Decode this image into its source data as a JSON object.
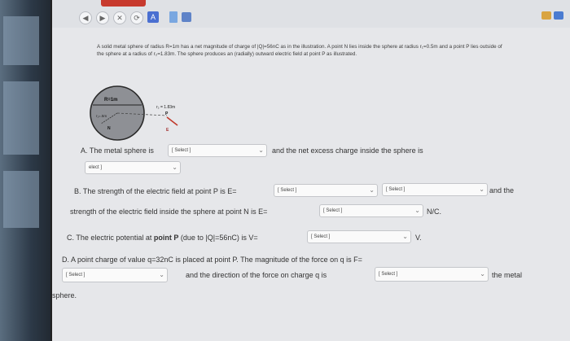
{
  "browser": {
    "toolbar_buttons": [
      "◀",
      "▶",
      "✕",
      "⟳",
      "A"
    ],
    "accent_tab_color": "#c73a2e"
  },
  "problem": {
    "intro": "A solid metal sphere of radius R=1m has a net magnitude of charge of |Q|=56nC as in the illustration. A point N lies inside the sphere at radius r₁=0.5m and a point P lies outside of the sphere at a radius of r₂=1.83m. The sphere produces an (radially) outward electric field at point P as illustrated."
  },
  "diagram": {
    "radius_label": "R=1m",
    "r1_label": "r₁=.5m",
    "n_label": "N",
    "r2_label": "r₂ = 1.83m",
    "p_label": "P",
    "e_label": "E"
  },
  "questions": {
    "a_prefix": "A. The metal sphere is",
    "a_mid": "and the net excess charge inside the sphere is",
    "b_prefix": "B. The strength of the electric field at point P is E=",
    "b_suffix": "and the",
    "b_line2": "strength of the electric field inside the sphere at point N is E=",
    "b_unit": "N/C.",
    "c_prefix": "C. The electric potential at",
    "c_bold": "point P",
    "c_middle": "(due to |Q|=56nC) is V=",
    "c_unit": "V.",
    "d_line1": "D. A point charge of value q=32nC is placed at point P.  The magnitude of the force on q is F=",
    "d_mid": "and the direction of the force on charge q is",
    "d_suffix": "the metal",
    "d_line3": "sphere."
  },
  "selects": {
    "placeholder": "[ Select ]",
    "partial_placeholder": "elect ]"
  }
}
